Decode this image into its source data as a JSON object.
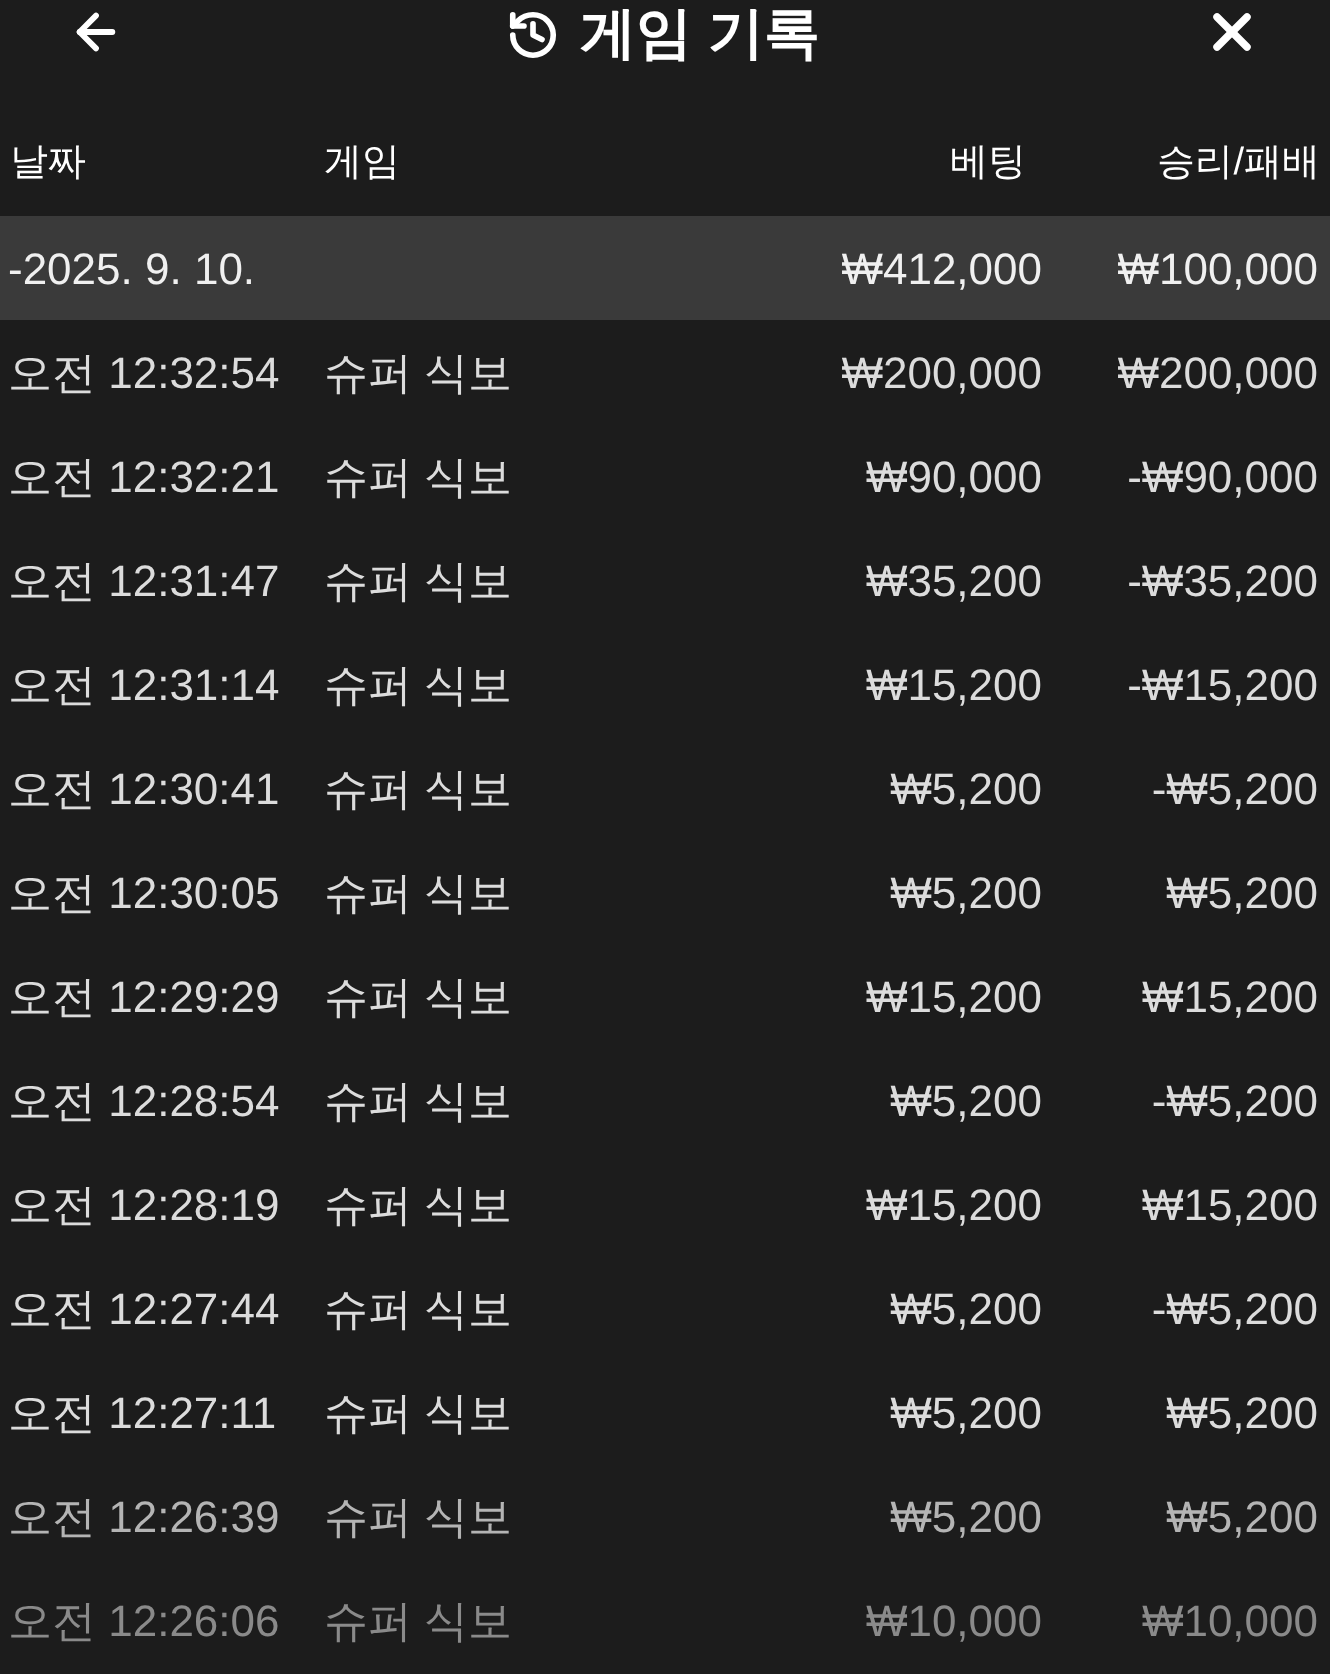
{
  "header": {
    "title": "게임 기록"
  },
  "table": {
    "columns": [
      "날짜",
      "게임",
      "베팅",
      "승리/패배"
    ],
    "group": {
      "date": "-2025. 9. 10.",
      "bet": "₩412,000",
      "result": "₩100,000"
    },
    "rows": [
      {
        "time": "오전 12:32:54",
        "game": "슈퍼 식보",
        "bet": "₩200,000",
        "result": "₩200,000"
      },
      {
        "time": "오전 12:32:21",
        "game": "슈퍼 식보",
        "bet": "₩90,000",
        "result": "-₩90,000"
      },
      {
        "time": "오전 12:31:47",
        "game": "슈퍼 식보",
        "bet": "₩35,200",
        "result": "-₩35,200"
      },
      {
        "time": "오전 12:31:14",
        "game": "슈퍼 식보",
        "bet": "₩15,200",
        "result": "-₩15,200"
      },
      {
        "time": "오전 12:30:41",
        "game": "슈퍼 식보",
        "bet": "₩5,200",
        "result": "-₩5,200"
      },
      {
        "time": "오전 12:30:05",
        "game": "슈퍼 식보",
        "bet": "₩5,200",
        "result": "₩5,200"
      },
      {
        "time": "오전 12:29:29",
        "game": "슈퍼 식보",
        "bet": "₩15,200",
        "result": "₩15,200"
      },
      {
        "time": "오전 12:28:54",
        "game": "슈퍼 식보",
        "bet": "₩5,200",
        "result": "-₩5,200"
      },
      {
        "time": "오전 12:28:19",
        "game": "슈퍼 식보",
        "bet": "₩15,200",
        "result": "₩15,200"
      },
      {
        "time": "오전 12:27:44",
        "game": "슈퍼 식보",
        "bet": "₩5,200",
        "result": "-₩5,200"
      },
      {
        "time": "오전 12:27:11",
        "game": "슈퍼 식보",
        "bet": "₩5,200",
        "result": "₩5,200"
      },
      {
        "time": "오전 12:26:39",
        "game": "슈퍼 식보",
        "bet": "₩5,200",
        "result": "₩5,200"
      },
      {
        "time": "오전 12:26:06",
        "game": "슈퍼 식보",
        "bet": "₩10,000",
        "result": "₩10,000"
      }
    ]
  }
}
